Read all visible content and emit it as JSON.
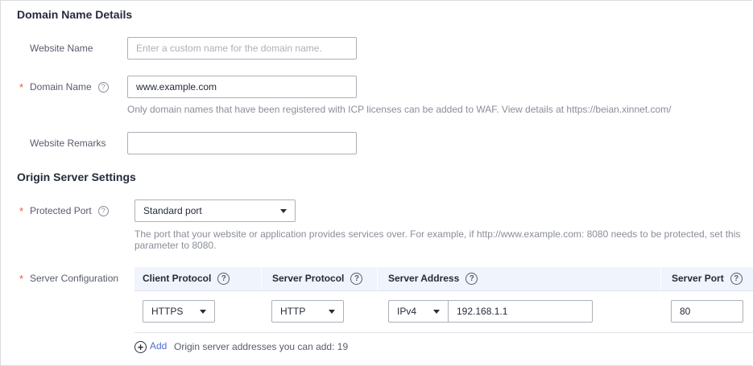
{
  "domain_details": {
    "title": "Domain Name Details",
    "website_name": {
      "label": "Website Name",
      "value": "",
      "placeholder": "Enter a custom name for the domain name."
    },
    "domain_name": {
      "label": "Domain Name",
      "required": "*",
      "value": "www.example.com",
      "hint": "Only domain names that have been registered with ICP licenses can be added to WAF. View details at https://beian.xinnet.com/"
    },
    "website_remarks": {
      "label": "Website Remarks",
      "value": ""
    }
  },
  "origin_settings": {
    "title": "Origin Server Settings",
    "protected_port": {
      "label": "Protected Port",
      "required": "*",
      "value": "Standard port",
      "hint_line1": "The port that your website or application provides services over. For example, if http://www.example.com: 8080 needs to be protected, set this",
      "hint_line2": "parameter to 8080."
    },
    "server_config": {
      "label": "Server Configuration",
      "required": "*",
      "columns": {
        "client_protocol": "Client Protocol",
        "server_protocol": "Server Protocol",
        "server_address": "Server Address",
        "server_port": "Server Port"
      },
      "row": {
        "client_protocol": "HTTPS",
        "server_protocol": "HTTP",
        "ip_version": "IPv4",
        "address": "192.168.1.1",
        "port": "80"
      },
      "add_label": "Add",
      "add_note": "Origin server addresses you can add: 19"
    }
  },
  "help_glyph": "?",
  "colors": {
    "required": "#e85a3c",
    "link": "#526ecc",
    "table_header_bg": "#f0f4fc"
  }
}
